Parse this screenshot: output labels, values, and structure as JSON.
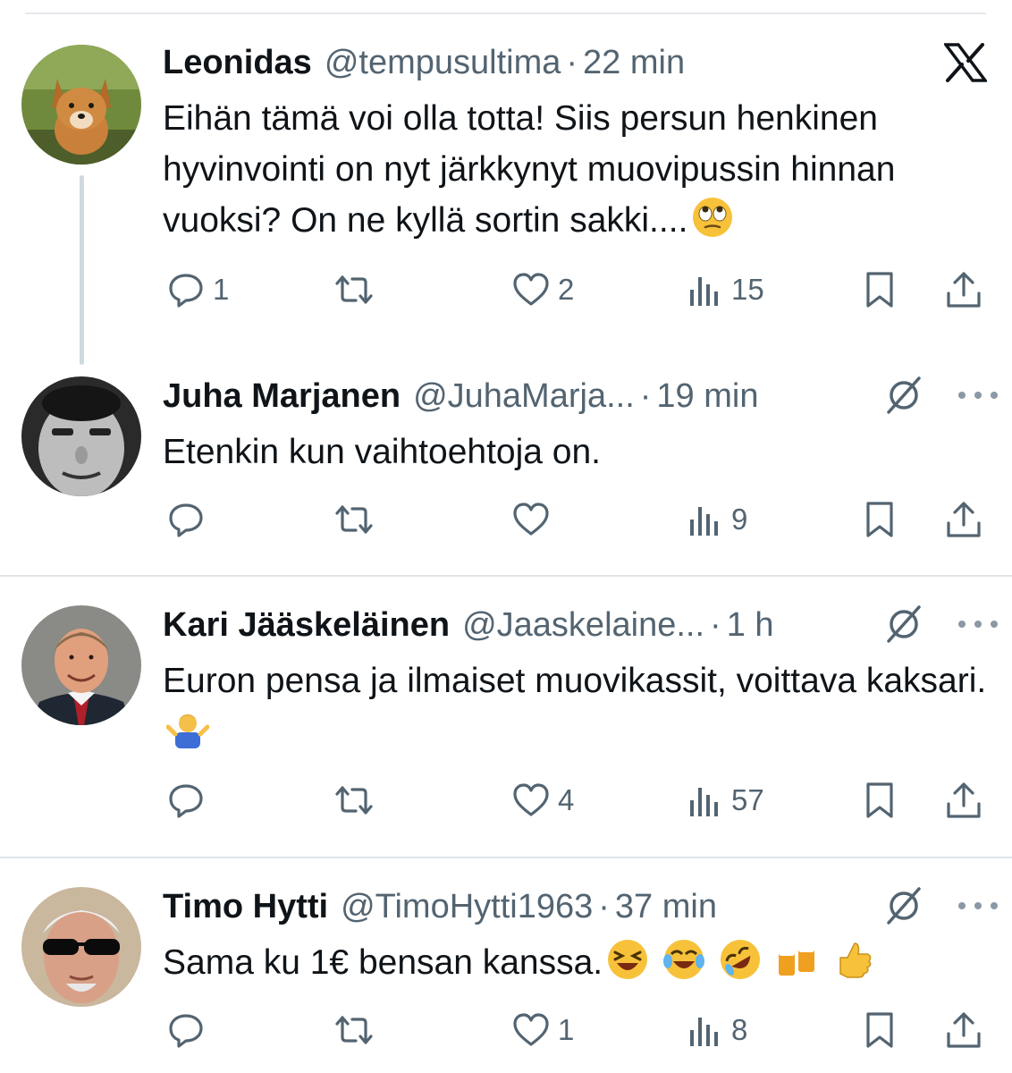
{
  "app": {
    "logo": "x-logo-icon"
  },
  "posts": [
    {
      "name": "Leonidas",
      "handle": "@tempusultima",
      "separator": "·",
      "time": "22 min",
      "text": "Eihän tämä voi olla totta! Siis persun henkinen hyvinvointi on nyt järkkynyt muovipussin hinnan vuoksi? On ne kyllä sortin sakki....",
      "emojis": [
        "eye-roll-emoji"
      ],
      "avatar": "fox-avatar",
      "replies": "1",
      "retweets": "",
      "likes": "2",
      "views": "15"
    },
    {
      "name": "Juha Marjanen",
      "handle": "@JuhaMarja...",
      "separator": "·",
      "time": "19 min",
      "text": "Etenkin kun vaihtoehtoja on.",
      "avatar": "man-bw-avatar",
      "replies": "",
      "retweets": "",
      "likes": "",
      "views": "9"
    },
    {
      "name": "Kari Jääskeläinen",
      "handle": "@Jaaskelaine...",
      "separator": "·",
      "time": "1 h",
      "text": "Euron pensa ja ilmaiset muovikassit, voittava kaksari.",
      "emojis": [
        "shrug-emoji"
      ],
      "avatar": "man-suit-avatar",
      "replies": "",
      "retweets": "",
      "likes": "4",
      "views": "57"
    },
    {
      "name": "Timo Hytti",
      "handle": "@TimoHytti1963",
      "separator": "·",
      "time": "37 min",
      "text": "Sama ku 1€ bensan kanssa.",
      "emojis": [
        "grinning-squinting-emoji",
        "tears-of-joy-emoji",
        "rolling-laughing-emoji",
        "beer-mugs-emoji",
        "thumbs-up-emoji"
      ],
      "avatar": "man-sunglasses-avatar",
      "replies": "",
      "retweets": "",
      "likes": "1",
      "views": "8"
    }
  ],
  "colors": {
    "text": "#0f1419",
    "secondary": "#536471",
    "divider": "#e1e5e9",
    "thread": "#cfd9de"
  }
}
